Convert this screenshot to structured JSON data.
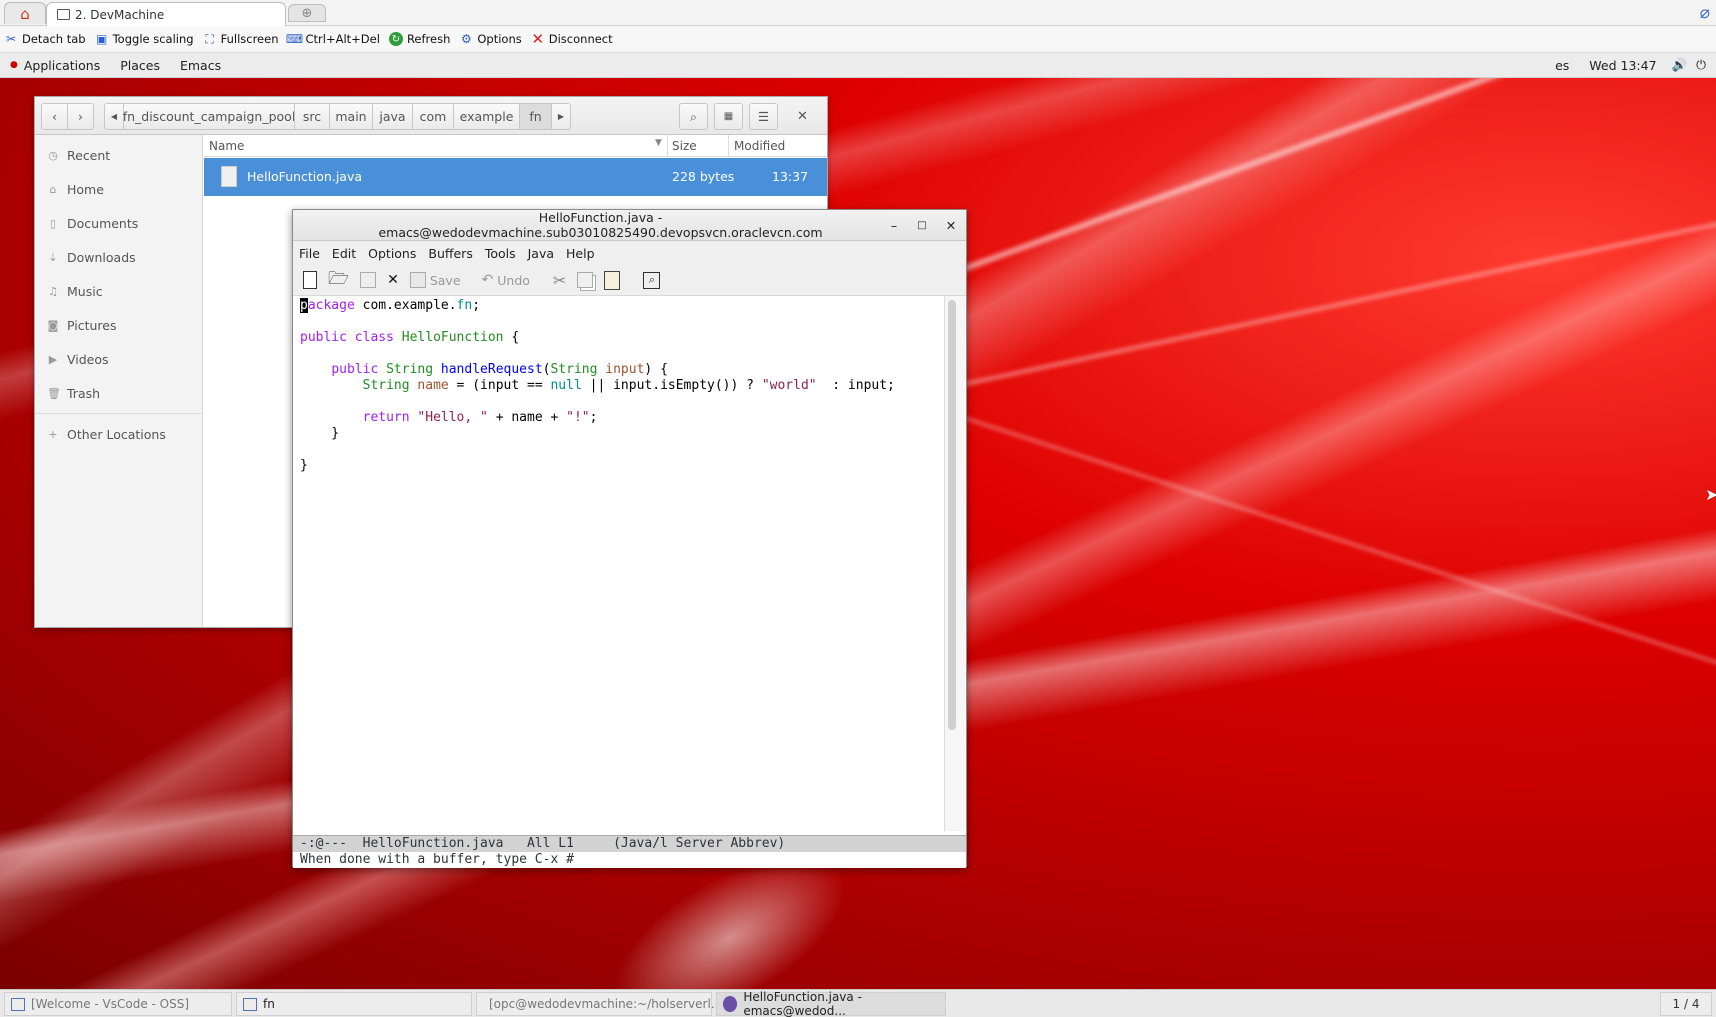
{
  "browser": {
    "tab_title": "2. DevMachine",
    "toolbar": [
      "Detach tab",
      "Toggle scaling",
      "Fullscreen",
      "Ctrl+Alt+Del",
      "Refresh",
      "Options",
      "Disconnect"
    ]
  },
  "panel": {
    "applications": "Applications",
    "places": "Places",
    "emacs": "Emacs",
    "lang": "es",
    "clock": "Wed 13:47"
  },
  "nautilus": {
    "path": [
      "fn_discount_campaign_pool",
      "src",
      "main",
      "java",
      "com",
      "example",
      "fn"
    ],
    "sidebar": [
      "Recent",
      "Home",
      "Documents",
      "Downloads",
      "Music",
      "Pictures",
      "Videos",
      "Trash",
      "Other Locations"
    ],
    "columns": {
      "name": "Name",
      "size": "Size",
      "modified": "Modified"
    },
    "file": {
      "name": "HelloFunction.java",
      "size": "228 bytes",
      "modified": "13:37"
    }
  },
  "emacs": {
    "title": "HelloFunction.java - emacs@wedodevmachine.sub03010825490.devopsvcn.oraclevcn.com",
    "menu": [
      "File",
      "Edit",
      "Options",
      "Buffers",
      "Tools",
      "Java",
      "Help"
    ],
    "save_label": "Save",
    "undo_label": "Undo",
    "modeline": "-:@---  HelloFunction.java   All L1     (Java/l Server Abbrev)",
    "minibuffer": "When done with a buffer, type C-x #"
  },
  "taskbar": {
    "items": [
      "[Welcome - VsCode - OSS]",
      "fn",
      "[opc@wedodevmachine:~/holserverl...",
      "HelloFunction.java - emacs@wedod..."
    ],
    "workspace": "1 / 4"
  }
}
